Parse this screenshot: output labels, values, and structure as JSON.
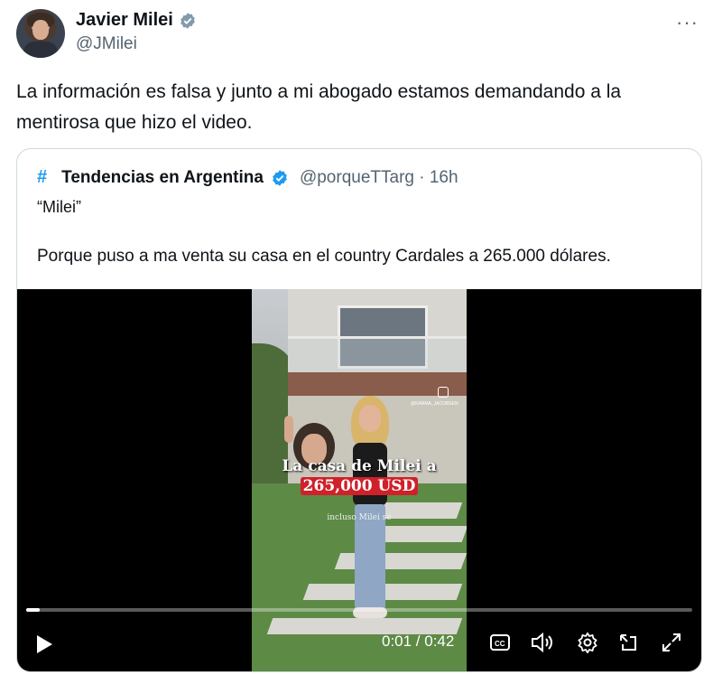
{
  "author": {
    "name": "Javier Milei",
    "handle": "@JMilei",
    "more_icon": "more-horizontal-icon"
  },
  "tweet": {
    "text": "La información es falsa y junto a mi abogado estamos demandando a la mentirosa que hizo el video."
  },
  "quoted": {
    "hash": "#",
    "name": "Tendencias en Argentina",
    "meta": "@porqueTTarg · 16h",
    "quote": "“Milei”",
    "body": "Porque puso a ma venta su casa en el country Cardales a 265.000 dólares."
  },
  "video": {
    "overlay_line1": "La casa de Milei a",
    "overlay_line2": "265,000 USD",
    "overlay_line3": "incluso Milei se",
    "watermark": "@KARMA_JACOBSEN",
    "time": "0:01 / 0:42",
    "progress": 0.02,
    "icons": [
      "play-icon",
      "captions-icon",
      "volume-icon",
      "settings-icon",
      "share-icon",
      "fullscreen-icon"
    ]
  },
  "colors": {
    "accent": "#1d9bf0",
    "text": "#0f1419",
    "secondary": "#536471",
    "border": "#cfd9de",
    "price_banner": "#d0202a"
  }
}
